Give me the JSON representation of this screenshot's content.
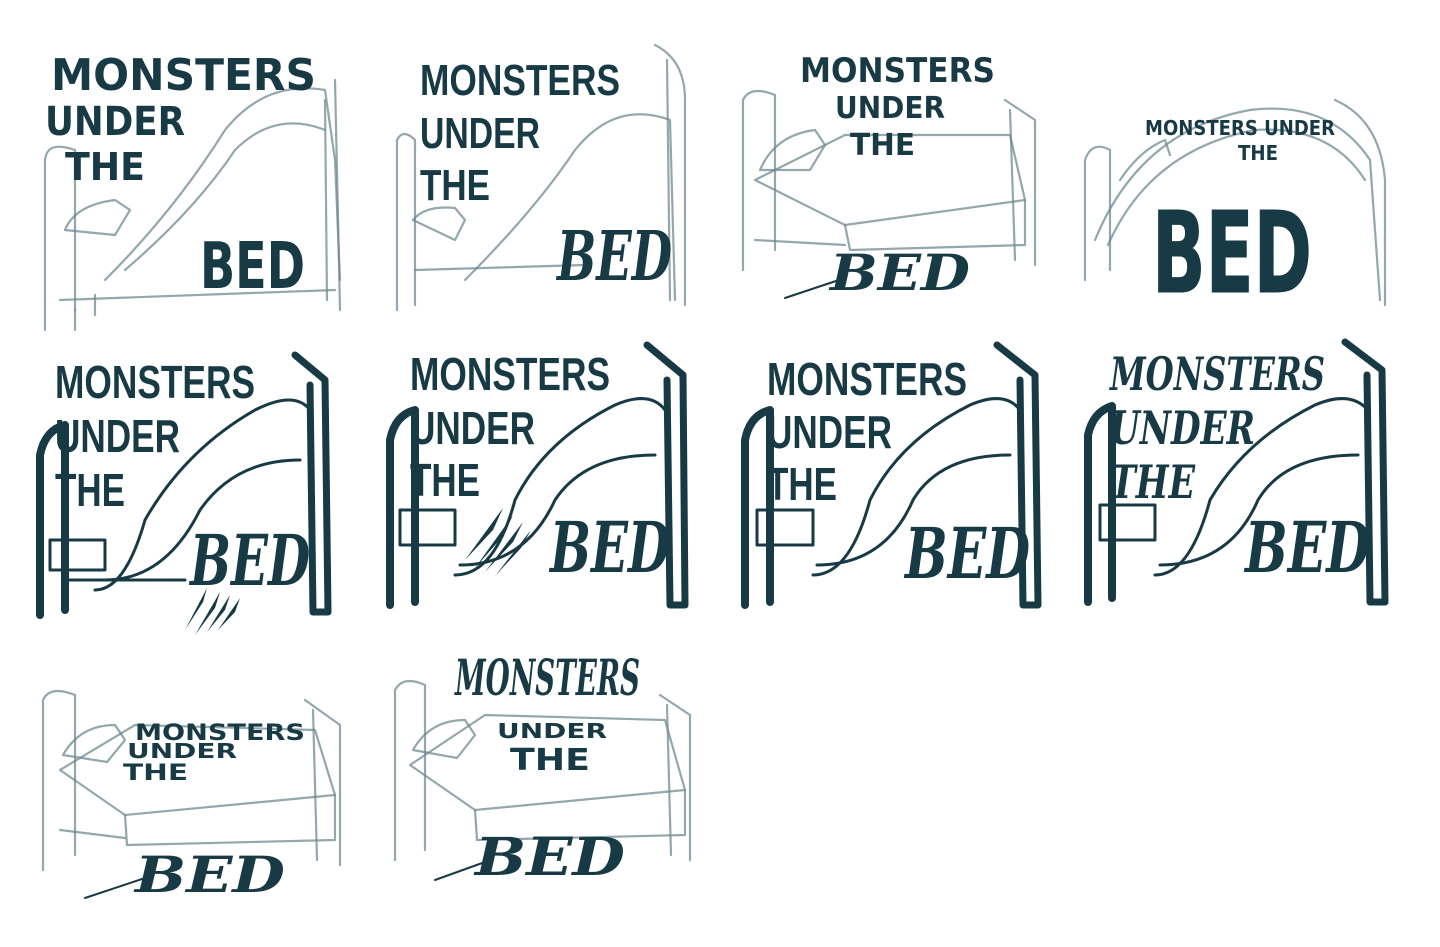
{
  "concepts": [
    {
      "id": 1,
      "lines": [
        "MONSTERS",
        "UNDER",
        "THE",
        "BED"
      ]
    },
    {
      "id": 2,
      "lines": [
        "MONSTERS",
        "UNDER",
        "THE",
        "BED"
      ]
    },
    {
      "id": 3,
      "lines": [
        "MONSTERS",
        "UNDER",
        "THE",
        "BED"
      ]
    },
    {
      "id": 4,
      "lines": [
        "MONSTERS UNDER",
        "THE",
        "BED"
      ]
    },
    {
      "id": 5,
      "lines": [
        "MONSTERS",
        "UNDER",
        "THE",
        "BED"
      ]
    },
    {
      "id": 6,
      "lines": [
        "MONSTERS",
        "UNDER",
        "THE",
        "BED"
      ]
    },
    {
      "id": 7,
      "lines": [
        "MONSTERS",
        "UNDER",
        "THE",
        "BED"
      ]
    },
    {
      "id": 8,
      "lines": [
        "MONSTERS",
        "UNDER",
        "THE",
        "BED"
      ]
    },
    {
      "id": 9,
      "lines": [
        "MONSTERS",
        "UNDER",
        "THE",
        "BED"
      ]
    },
    {
      "id": 10,
      "lines": [
        "MONSTERS",
        "UNDER",
        "THE",
        "BED"
      ]
    }
  ],
  "colors": {
    "ink": "#173a44",
    "sketch": "#6f8a92",
    "background": "#ffffff"
  }
}
